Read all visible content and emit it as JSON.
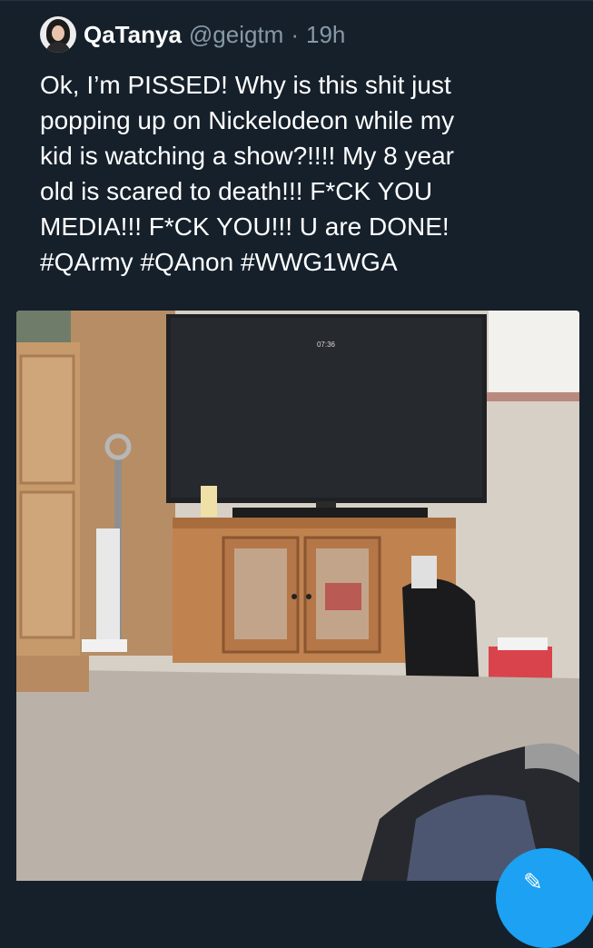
{
  "tweet": {
    "display_name": "QaTanya",
    "handle": "@geigtm",
    "separator": "·",
    "time": "19h",
    "text": "Ok, I’m PISSED! Why is this shit just\npopping up on Nickelodeon while my\nkid is watching a show?!!!! My 8 year\nold is scared to death!!! F*CK YOU\nMEDIA!!! F*CK YOU!!! U are DONE!\n#QArmy #QAnon #WWG1WGA"
  },
  "media": {
    "tv_screen_text": "07:36"
  },
  "icons": {
    "avatar": "avatar-icon",
    "compose": "compose-icon"
  },
  "colors": {
    "background": "#15202b",
    "primary_text": "#ffffff",
    "secondary_text": "#8899a6",
    "accent": "#1da1f2"
  }
}
